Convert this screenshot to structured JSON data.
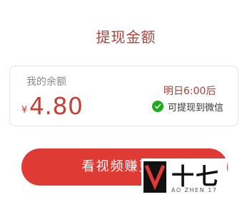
{
  "dialog": {
    "title": "提现金额"
  },
  "balance_card": {
    "label": "我的余额",
    "currency": "¥",
    "amount": "4.80",
    "time": "明日6:00后",
    "status": "可提现到微信",
    "status_icon": "wechat-check-icon",
    "status_color": "#1aad19"
  },
  "actions": {
    "primary_label": "看视频赚更多"
  },
  "watermark": {
    "text": "十七",
    "subtext": "AO ZHEN 17"
  },
  "colors": {
    "accent": "#a5433c",
    "amount": "#c44136",
    "button": "#e03a35"
  }
}
